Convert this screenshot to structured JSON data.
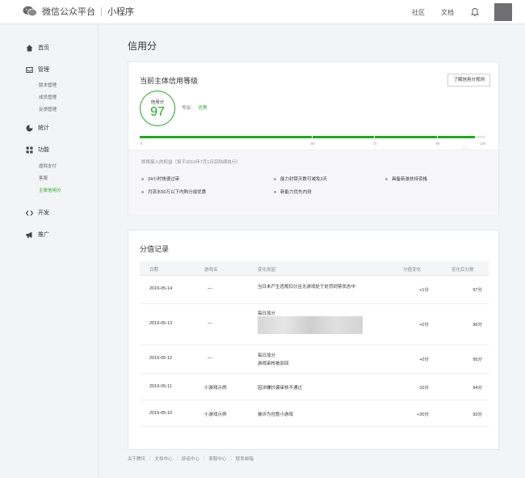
{
  "topbar": {
    "brand": "微信公众平台",
    "separator": "|",
    "product": "小程序",
    "links": [
      {
        "label": "社区"
      },
      {
        "label": "文档"
      }
    ]
  },
  "sidebar": {
    "groups": [
      {
        "icon": "home-icon",
        "label": "首页"
      },
      {
        "icon": "inbox-icon",
        "label": "管理",
        "subs": [
          "版本管理",
          "成员管理",
          "反馈管理"
        ]
      },
      {
        "icon": "chart-icon",
        "label": "统计"
      },
      {
        "icon": "grid-icon",
        "label": "功能",
        "subs": [
          "虚拟支付",
          "客服",
          "主体信用分"
        ]
      },
      {
        "icon": "code-icon",
        "label": "开发"
      },
      {
        "icon": "megaphone-icon",
        "label": "推广"
      }
    ]
  },
  "page": {
    "title": "信用分"
  },
  "credit": {
    "card_title": "当前主体信用等级",
    "rules_button": "了解信用分规则",
    "score_label": "信用分",
    "score": "97",
    "level_label": "等级：",
    "level": "优秀",
    "progress": 0.97,
    "ticks": [
      "0",
      "50",
      "70",
      "90",
      "100"
    ],
    "benefits_title": "即将接入的权益（将于2019年7月1日后陆续执行）",
    "benefits": [
      "24小时快速过审",
      "能力封禁天数可减免3天",
      "具备新游扶持资格",
      "月流水50万以下内购分成优惠",
      "新能力优先内测"
    ]
  },
  "records": {
    "card_title": "分值记录",
    "headers": [
      "日期",
      "游戏名",
      "变化原因",
      "分值变化",
      "变化后分数"
    ],
    "rows": [
      {
        "date": "2019-05-14",
        "game": "—",
        "reason": "当日未产生违规扣分且无游戏处于处罚封禁状态中",
        "change": "+1分",
        "score": "97分"
      },
      {
        "date": "2019-05-13",
        "game": "—",
        "reason": "每日加分",
        "change": "+0分",
        "score": "96分"
      },
      {
        "date": "2019-05-12",
        "game": "—",
        "reason": "每日加分",
        "reason2": "游戏审核被驳回",
        "change": "+0分",
        "score": "95分"
      },
      {
        "date": "2019-05-11",
        "game": "小游戏示例",
        "reason": "因涉嫌抄袭审核不通过",
        "change": "-10分",
        "score": "94分"
      },
      {
        "date": "2019-05-10",
        "game": "小游戏示例",
        "reason": "被评为创意小游戏",
        "change": "+20分",
        "score": "93分"
      }
    ]
  },
  "footer": {
    "links": [
      "关于腾讯",
      "文档中心",
      "辟谣中心",
      "客服中心",
      "联系邮箱"
    ]
  },
  "colors": {
    "accent": "#1aad19"
  }
}
